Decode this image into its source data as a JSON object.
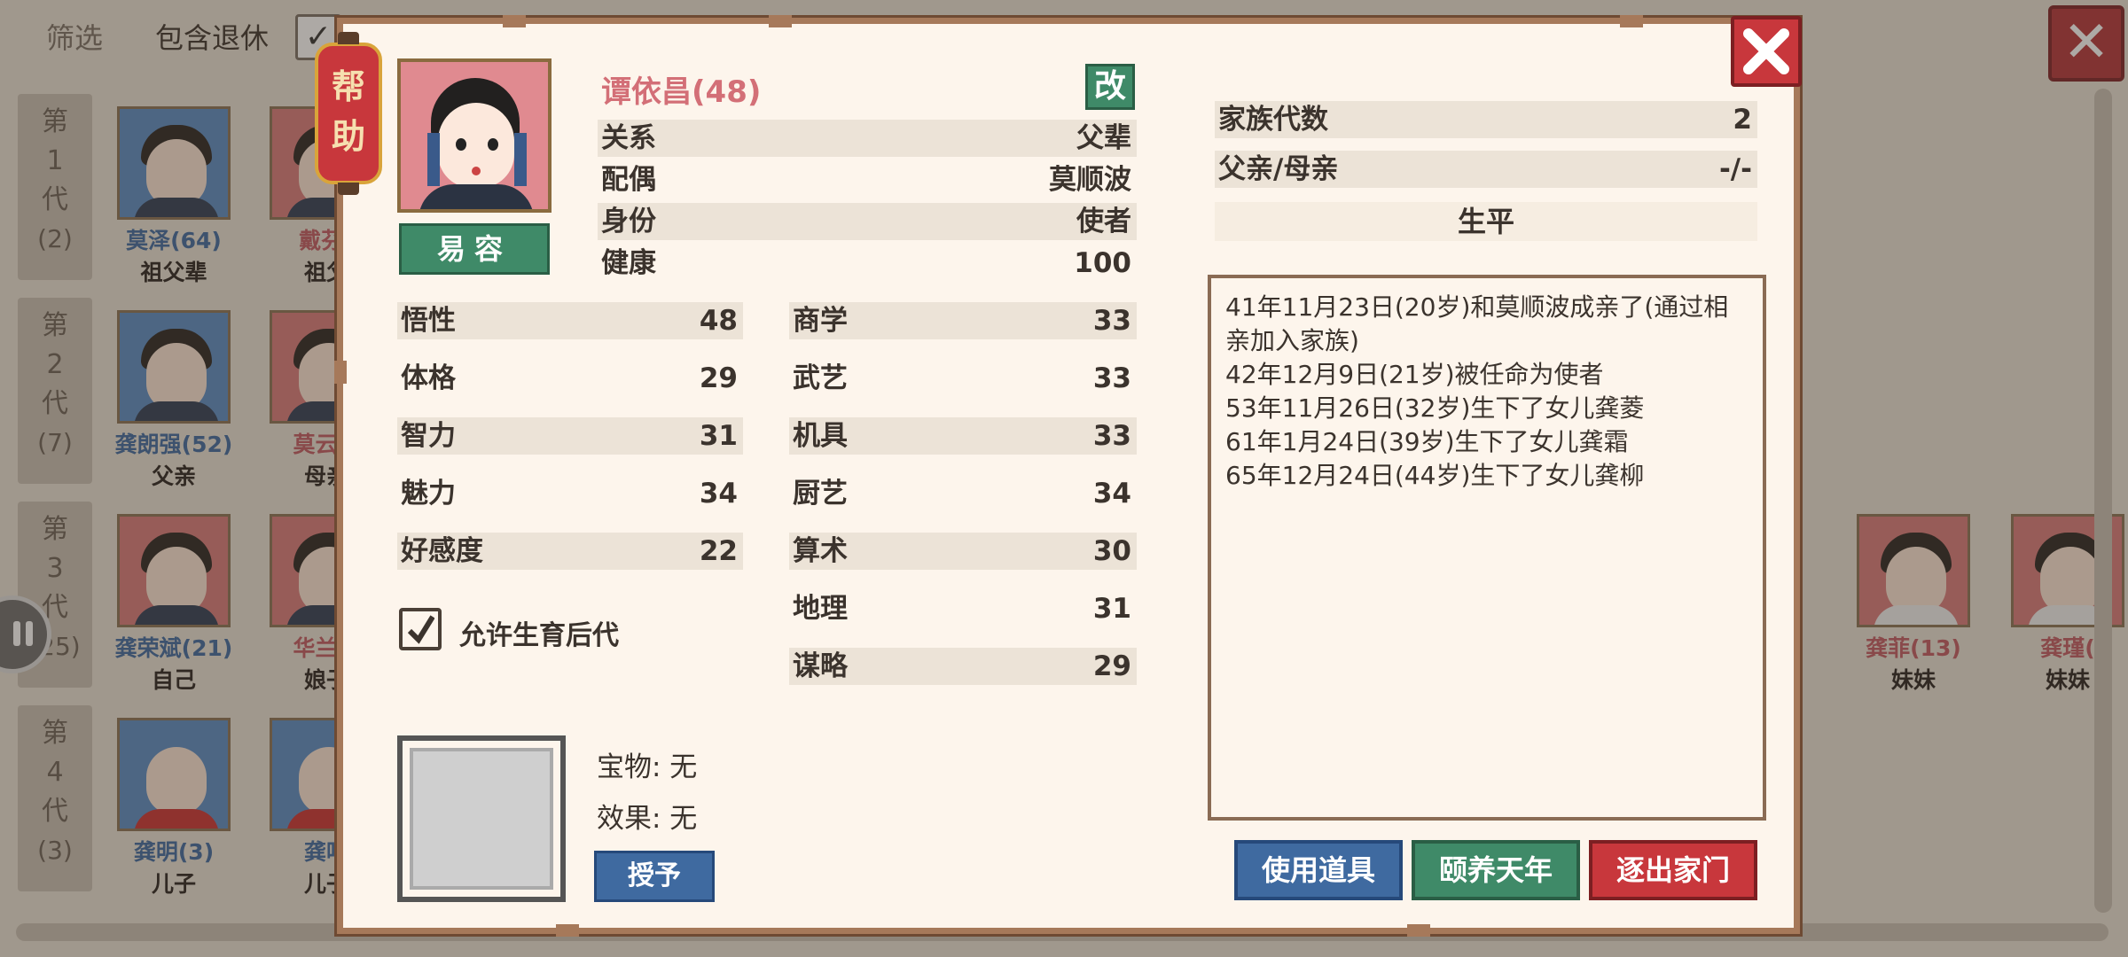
{
  "background": {
    "filter_label": "筛选",
    "include_retired_label": "包含退休",
    "generations": [
      {
        "label": "第\n1\n代",
        "count": "(2)"
      },
      {
        "label": "第\n2\n代",
        "count": "(7)"
      },
      {
        "label": "第\n3\n代",
        "count": "(25)"
      },
      {
        "label": "第\n4\n代",
        "count": "(3)"
      }
    ],
    "members": [
      {
        "name": "莫泽(64)",
        "relation": "祖父辈"
      },
      {
        "name": "戴芬(",
        "relation": "祖父"
      },
      {
        "name": "龚朗强(52)",
        "relation": "父亲"
      },
      {
        "name": "莫云泽",
        "relation": "母亲"
      },
      {
        "name": "龚荣斌(21)",
        "relation": "自己"
      },
      {
        "name": "华兰彼",
        "relation": "娘子"
      },
      {
        "name": "龚明(3)",
        "relation": "儿子"
      },
      {
        "name": "龚鸣",
        "relation": "儿子"
      },
      {
        "name": "龚菲(13)",
        "relation": "妹妹"
      },
      {
        "name": "龚瑾(",
        "relation": "妹妹"
      }
    ]
  },
  "dialog": {
    "help_label": "帮\n助",
    "disguise_label": "易容",
    "name": "谭依昌(48)",
    "rename_label": "改",
    "info": [
      {
        "label": "关系",
        "value": "父辈"
      },
      {
        "label": "配偶",
        "value": "莫顺波"
      },
      {
        "label": "身份",
        "value": "使者"
      },
      {
        "label": "健康",
        "value": "100"
      }
    ],
    "stats_left": [
      {
        "label": "悟性",
        "value": "48"
      },
      {
        "label": "体格",
        "value": "29"
      },
      {
        "label": "智力",
        "value": "31"
      },
      {
        "label": "魅力",
        "value": "34"
      },
      {
        "label": "好感度",
        "value": "22"
      }
    ],
    "stats_right": [
      {
        "label": "商学",
        "value": "33"
      },
      {
        "label": "武艺",
        "value": "33"
      },
      {
        "label": "机具",
        "value": "33"
      },
      {
        "label": "厨艺",
        "value": "34"
      },
      {
        "label": "算术",
        "value": "30"
      },
      {
        "label": "地理",
        "value": "31"
      },
      {
        "label": "谋略",
        "value": "29"
      }
    ],
    "allow_offspring_label": "允许生育后代",
    "allow_offspring_checked": true,
    "treasure_line": "宝物: 无",
    "effect_line": "效果: 无",
    "give_label": "授予",
    "family_info": [
      {
        "label": "家族代数",
        "value": "2"
      },
      {
        "label": "父亲/母亲",
        "value": "-/-"
      }
    ],
    "life_title": "生平",
    "life_events": [
      "41年11月23日(20岁)和莫顺波成亲了(通过相亲加入家族)",
      "42年12月9日(21岁)被任命为使者",
      "53年11月26日(32岁)生下了女儿龚菱",
      "61年1月24日(39岁)生下了女儿龚霜",
      "65年12月24日(44岁)生下了女儿龚柳"
    ],
    "actions": {
      "use_item": "使用道具",
      "retire": "颐养天年",
      "expel": "逐出家门"
    }
  },
  "colors": {
    "frame": "#a6795a",
    "parchment": "#fdf5ec",
    "blue_button": "#3f6aa0",
    "green_button": "#3f8a68",
    "red_button": "#c8373c",
    "name_pink": "#d36f77"
  }
}
